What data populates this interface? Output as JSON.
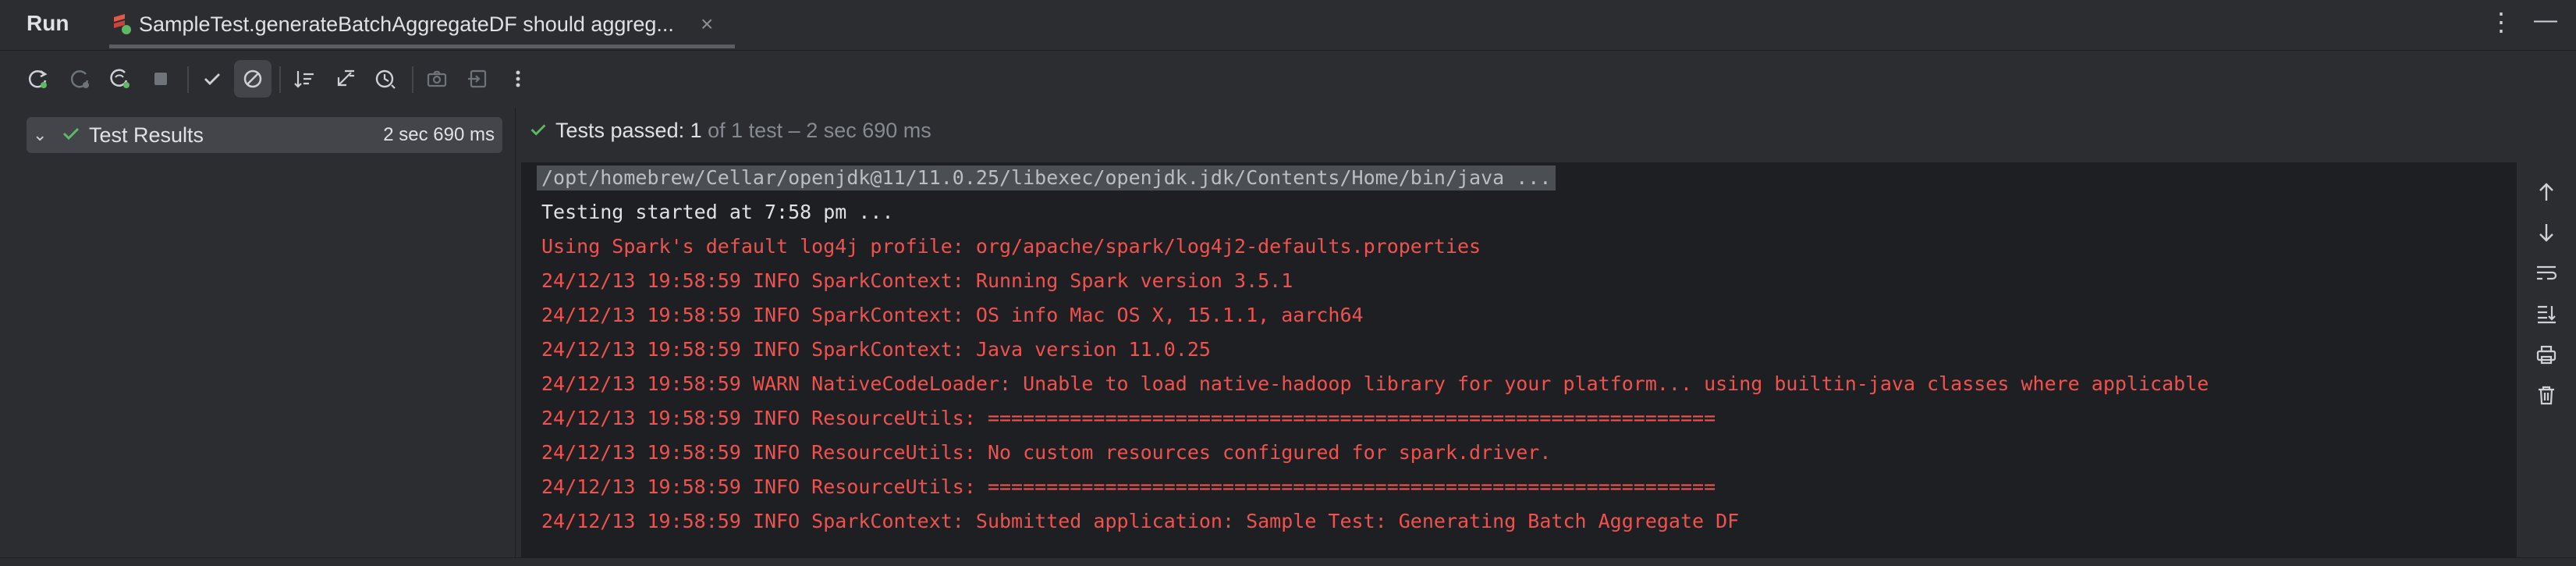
{
  "window": {
    "title": "Run",
    "tab_label": "SampleTest.generateBatchAggregateDF should aggreg...",
    "tab_close": "×",
    "more_glyph": "⋮",
    "minimize_glyph": "—"
  },
  "toolbar": {
    "items": [
      "rerun-icon",
      "rerun-failed-icon",
      "rerun-automatically-icon",
      "stop-icon",
      "show-passed-icon",
      "show-ignored-icon",
      "sort-alphabetically-icon",
      "sort-by-duration-icon",
      "history-icon",
      "screenshot-icon",
      "export-icon",
      "more-icon"
    ]
  },
  "tree": {
    "chevron": "⌄",
    "root_label": "Test Results",
    "root_time": "2 sec 690 ms"
  },
  "status": {
    "passed_label": "Tests passed:",
    "passed_count": " 1",
    "detail": " of 1 test – 2 sec 690 ms"
  },
  "console": {
    "command": "/opt/homebrew/Cellar/openjdk@11/11.0.25/libexec/openjdk.jdk/Contents/Home/bin/java ...",
    "lines": [
      "Testing started at 7:58 pm ...",
      "Using Spark's default log4j profile: org/apache/spark/log4j2-defaults.properties",
      "24/12/13 19:58:59 INFO SparkContext: Running Spark version 3.5.1",
      "24/12/13 19:58:59 INFO SparkContext: OS info Mac OS X, 15.1.1, aarch64",
      "24/12/13 19:58:59 INFO SparkContext: Java version 11.0.25",
      "24/12/13 19:58:59 WARN NativeCodeLoader: Unable to load native-hadoop library for your platform... using builtin-java classes where applicable",
      "24/12/13 19:58:59 INFO ResourceUtils: ==============================================================",
      "24/12/13 19:58:59 INFO ResourceUtils: No custom resources configured for spark.driver.",
      "24/12/13 19:58:59 INFO ResourceUtils: ==============================================================",
      "24/12/13 19:58:59 INFO SparkContext: Submitted application: Sample Test: Generating Batch Aggregate DF"
    ]
  },
  "right_toolbar": {
    "items": [
      "scroll-up-icon",
      "scroll-down-icon",
      "soft-wrap-icon",
      "scroll-to-end-icon",
      "print-icon",
      "clear-all-icon"
    ]
  },
  "colors": {
    "background": "#2b2d30",
    "console_bg": "#1e1f22",
    "success": "#5fb865",
    "stderr": "#f0524f",
    "stdout": "#dfe1e5"
  }
}
